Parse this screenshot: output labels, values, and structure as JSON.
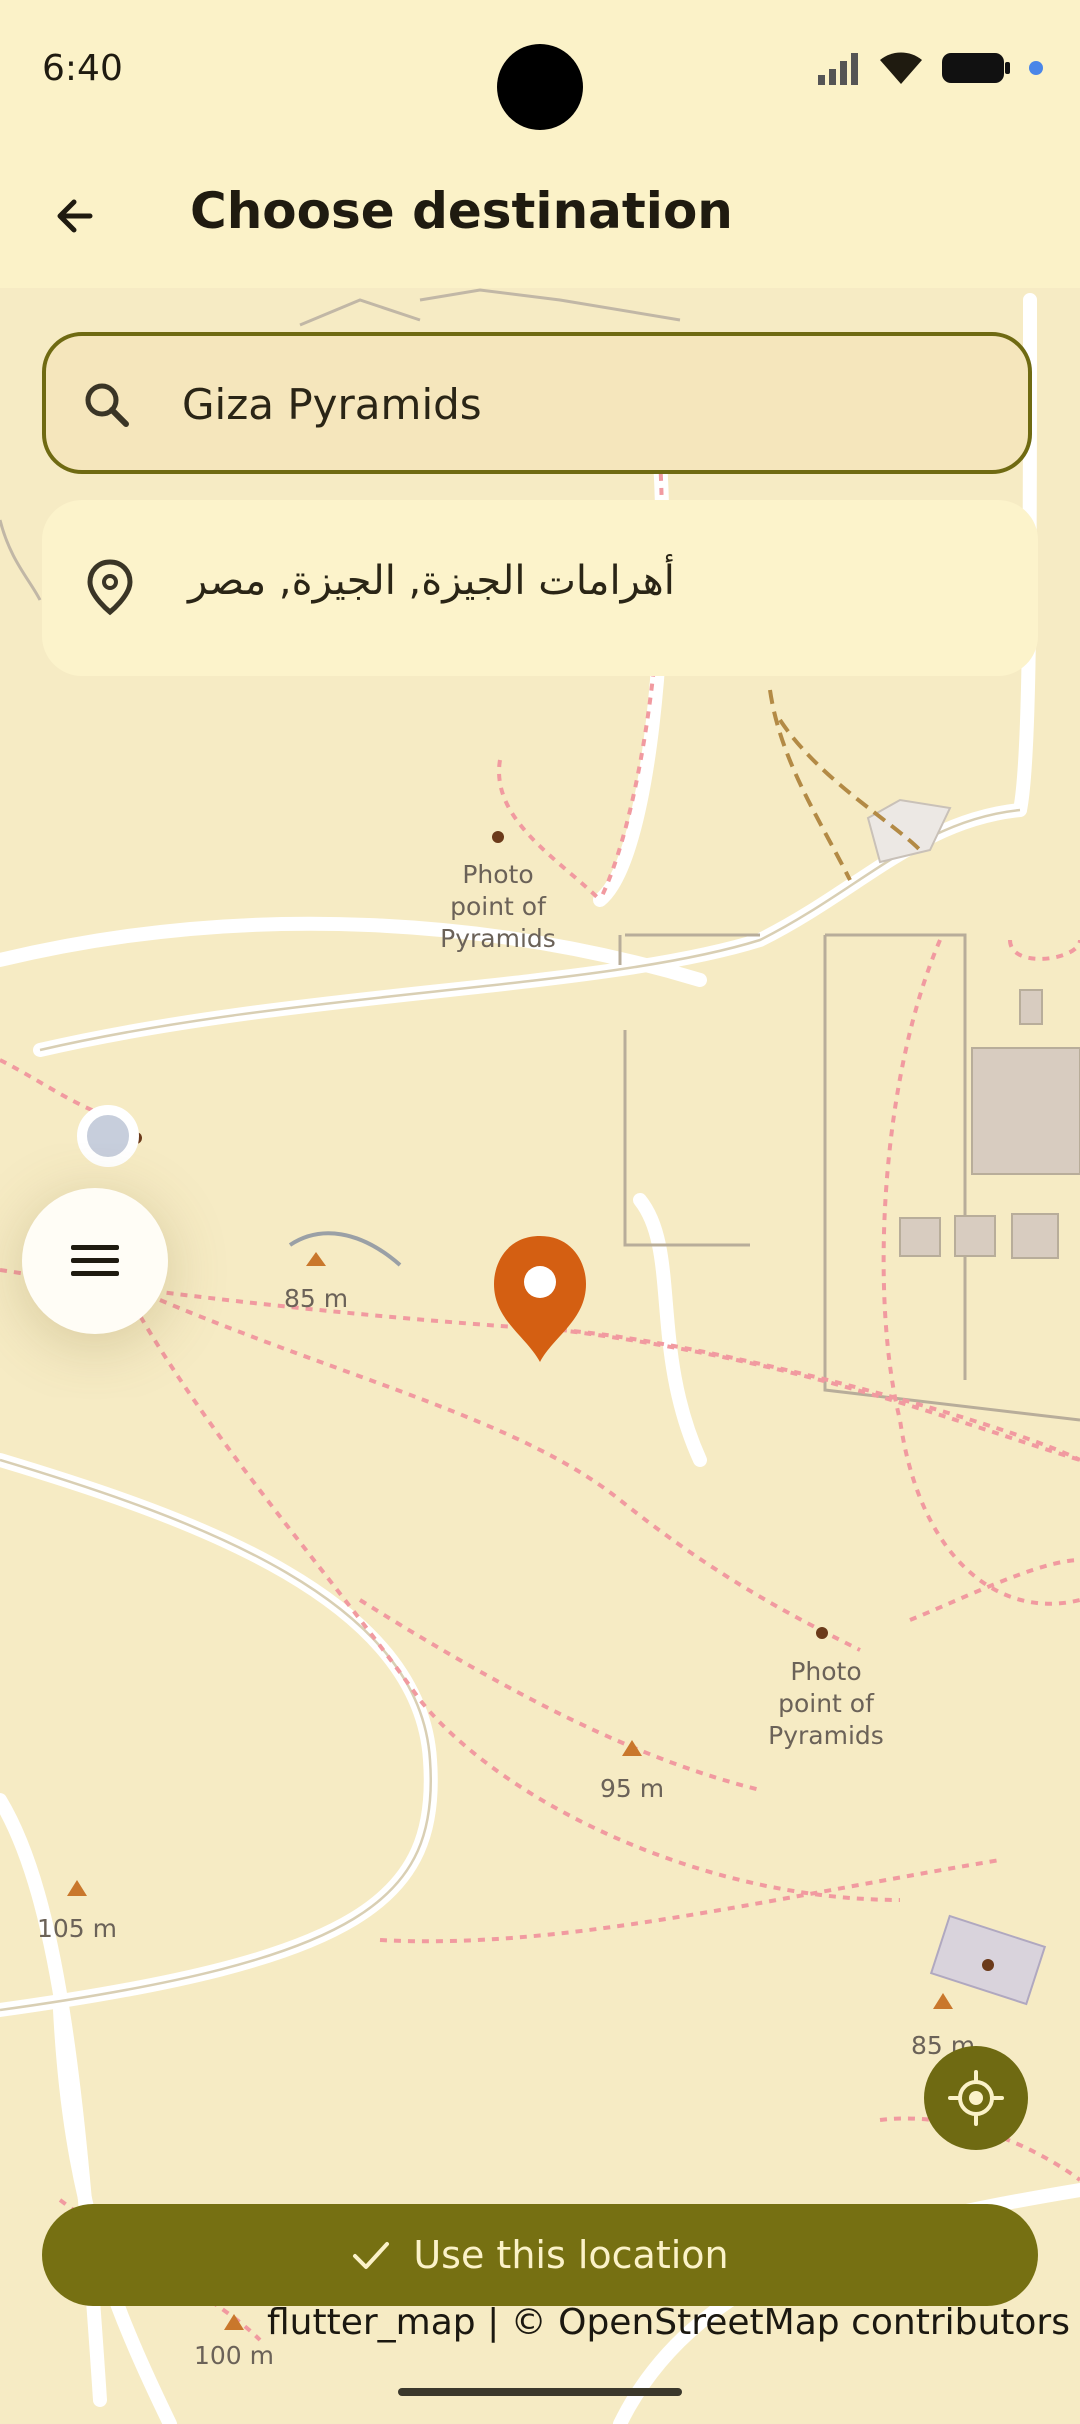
{
  "status_bar": {
    "time": "6:40"
  },
  "app_bar": {
    "title": "Choose destination",
    "back_icon": "arrow-left-icon"
  },
  "search": {
    "value": "Giza Pyramids",
    "icon": "search-icon"
  },
  "results": [
    {
      "label": "أهرامات الجيزة, الجيزة, مصر",
      "icon": "map-pin-icon"
    }
  ],
  "map": {
    "labels": {
      "photo_point_1": [
        "Photo",
        "point of",
        "Pyramids"
      ],
      "photo_point_2": [
        "Photo",
        "point of",
        "Pyramids"
      ],
      "elev_85_left": "85 m",
      "elev_95": "95 m",
      "elev_105": "105 m",
      "elev_85_right": "85 m",
      "elev_100": "100 m"
    }
  },
  "menu_button": {
    "icon": "menu-icon"
  },
  "locate_button": {
    "icon": "my-location-icon"
  },
  "use_button": {
    "label": "Use this location",
    "icon": "check-icon"
  },
  "attribution": "flutter_map | © OpenStreetMap contributors",
  "colors": {
    "accent": "#767012",
    "marker": "#d45f12",
    "background": "#fbf2c8"
  }
}
